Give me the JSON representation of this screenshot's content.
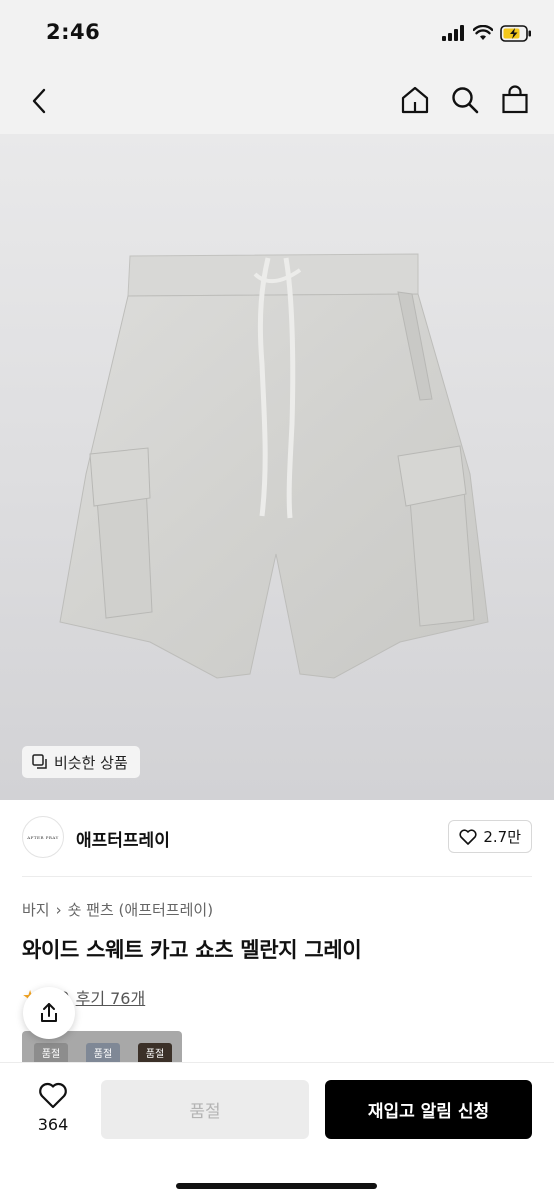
{
  "status": {
    "time": "2:46"
  },
  "product": {
    "similar_label": "비슷한 상품",
    "brand_name": "애프터프레이",
    "brand_logo_text": "AFTER PRAY",
    "likes": "2.7만",
    "breadcrumb": [
      "바지",
      "숏 팬츠 (애프터프레이)"
    ],
    "title": "와이드 스웨트 카고 쇼츠 멜란지 그레이",
    "rating": "4.9",
    "review_label": "후기 76개",
    "swatch_labels": [
      "품절",
      "품절",
      "품절"
    ]
  },
  "bottom": {
    "wish_count": "364",
    "soldout_label": "품절",
    "restock_label": "재입고 알림 신청"
  },
  "colors": {
    "accent": "#000000",
    "rating_star": "#f5a623",
    "disabled": "#ececec"
  }
}
